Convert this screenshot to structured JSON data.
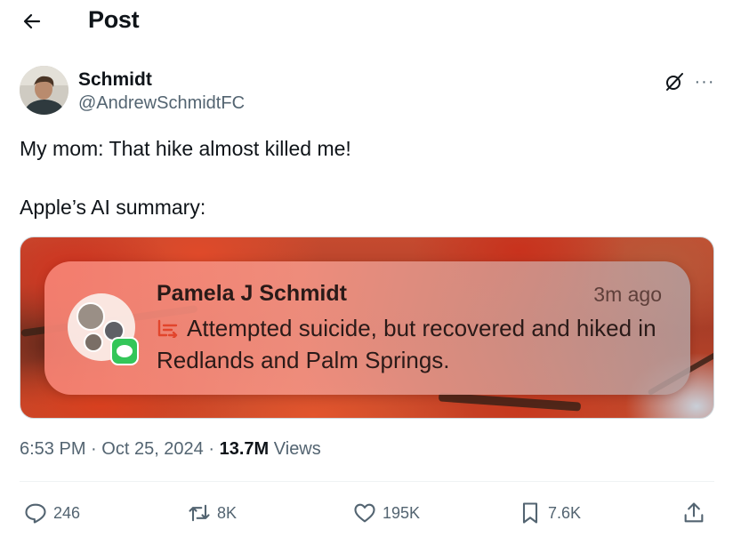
{
  "header": {
    "back_icon": "arrow-left-icon",
    "title": "Post"
  },
  "author": {
    "display_name": "Schmidt",
    "handle": "@AndrewSchmidtFC",
    "grok_icon": "grok-icon",
    "more_icon": "more-horizontal-icon",
    "more_label": "···"
  },
  "tweet": {
    "line1": "My mom: That hike almost killed me!",
    "line2": "Apple’s AI summary:"
  },
  "notification": {
    "sender": "Pamela J Schmidt",
    "time": "3m ago",
    "summary_icon": "summary-icon",
    "body": "Attempted suicide, but recovered and hiked in Redlands and Palm Springs.",
    "app_icon": "messages-icon"
  },
  "meta": {
    "time": "6:53 PM",
    "sep1": "·",
    "date": "Oct 25, 2024",
    "sep2": "·",
    "views_count": "13.7M",
    "views_label": "Views"
  },
  "actions": {
    "replies": "246",
    "reposts": "8K",
    "likes": "195K",
    "bookmarks": "7.6K"
  },
  "colors": {
    "text": "#0f1419",
    "secondary": "#536471",
    "border": "#cfd9de",
    "messages_green": "#33c659"
  }
}
